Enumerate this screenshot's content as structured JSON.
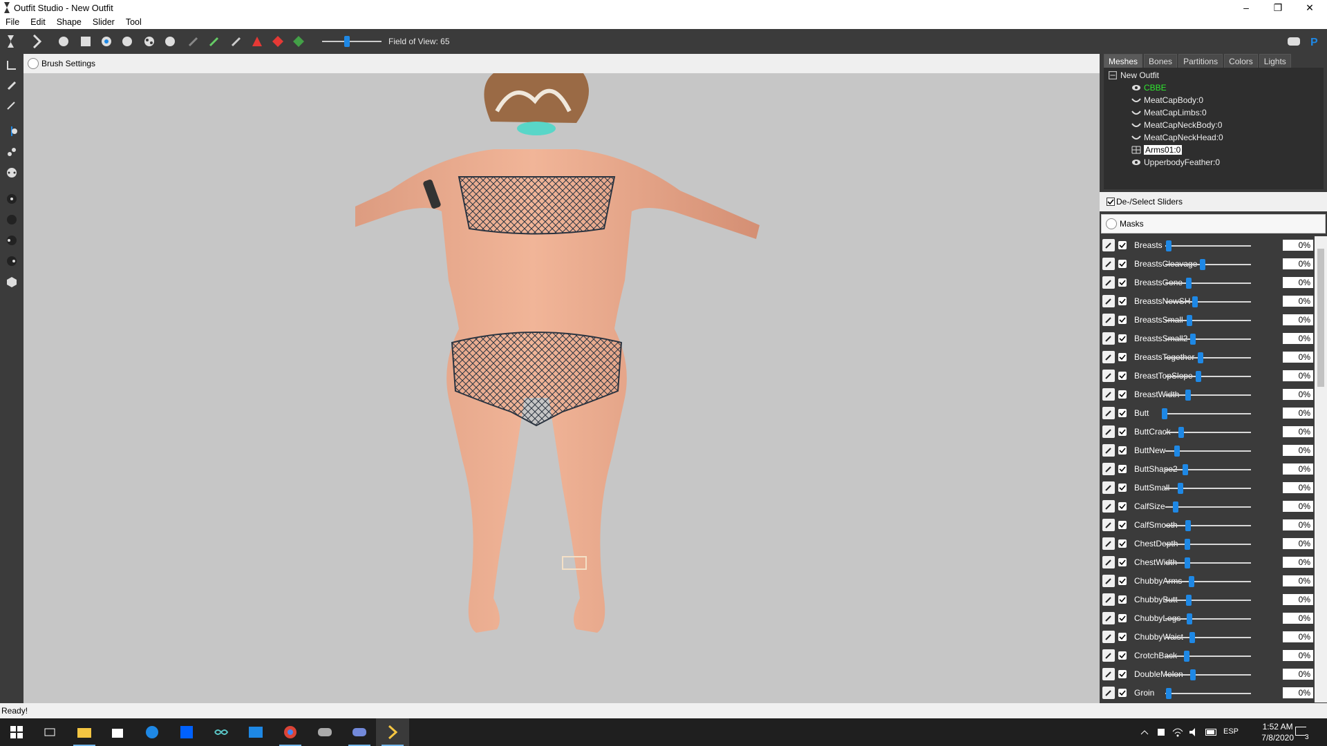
{
  "window": {
    "title": "Outfit Studio - New Outfit"
  },
  "menu": [
    "File",
    "Edit",
    "Shape",
    "Slider",
    "Tool"
  ],
  "toolbar": {
    "fov_label": "Field of View: 65",
    "fov_value": 65
  },
  "viewport": {
    "brush_settings_label": "Brush Settings"
  },
  "panel": {
    "tabs": [
      "Meshes",
      "Bones",
      "Partitions",
      "Colors",
      "Lights"
    ],
    "active_tab": "Meshes",
    "tree_root": "New Outfit",
    "meshes": [
      {
        "name": "CBBE",
        "icon": "eye-icon",
        "highlight": "#2ee82e"
      },
      {
        "name": "MeatCapBody:0",
        "icon": "arc-icon"
      },
      {
        "name": "MeatCapLimbs:0",
        "icon": "arc-icon"
      },
      {
        "name": "MeatCapNeckBody:0",
        "icon": "arc-icon"
      },
      {
        "name": "MeatCapNeckHead:0",
        "icon": "arc-icon"
      },
      {
        "name": "Arms01:0",
        "icon": "grid-icon",
        "selected": true
      },
      {
        "name": "UpperbodyFeather:0",
        "icon": "eye-icon"
      }
    ],
    "deselect_label": "De-/Select Sliders",
    "masks_label": "Masks",
    "sliders": [
      {
        "name": "Breasts",
        "value": "0%"
      },
      {
        "name": "BreastsCleavage",
        "value": "0%"
      },
      {
        "name": "BreastsGone",
        "value": "0%"
      },
      {
        "name": "BreastsNewSH",
        "value": "0%"
      },
      {
        "name": "BreastsSmall",
        "value": "0%"
      },
      {
        "name": "BreastsSmall2",
        "value": "0%"
      },
      {
        "name": "BreastsTogether",
        "value": "0%"
      },
      {
        "name": "BreastTopSlope",
        "value": "0%"
      },
      {
        "name": "BreastWidth",
        "value": "0%"
      },
      {
        "name": "Butt",
        "value": "0%"
      },
      {
        "name": "ButtCrack",
        "value": "0%"
      },
      {
        "name": "ButtNew",
        "value": "0%"
      },
      {
        "name": "ButtShape2",
        "value": "0%"
      },
      {
        "name": "ButtSmall",
        "value": "0%"
      },
      {
        "name": "CalfSize",
        "value": "0%"
      },
      {
        "name": "CalfSmooth",
        "value": "0%"
      },
      {
        "name": "ChestDepth",
        "value": "0%"
      },
      {
        "name": "ChestWidth",
        "value": "0%"
      },
      {
        "name": "ChubbyArms",
        "value": "0%"
      },
      {
        "name": "ChubbyButt",
        "value": "0%"
      },
      {
        "name": "ChubbyLegs",
        "value": "0%"
      },
      {
        "name": "ChubbyWaist",
        "value": "0%"
      },
      {
        "name": "CrotchBack",
        "value": "0%"
      },
      {
        "name": "DoubleMelon",
        "value": "0%"
      },
      {
        "name": "Groin",
        "value": "0%"
      }
    ]
  },
  "status": {
    "text": "Ready!"
  },
  "taskbar": {
    "time": "1:52 AM",
    "date": "7/8/2020",
    "lang": "ESP",
    "notifications": "3"
  },
  "colors": {
    "accent": "#1e88e5",
    "toolbar_bg": "#3b3b3b",
    "viewport_bg": "#c6c6c6"
  }
}
